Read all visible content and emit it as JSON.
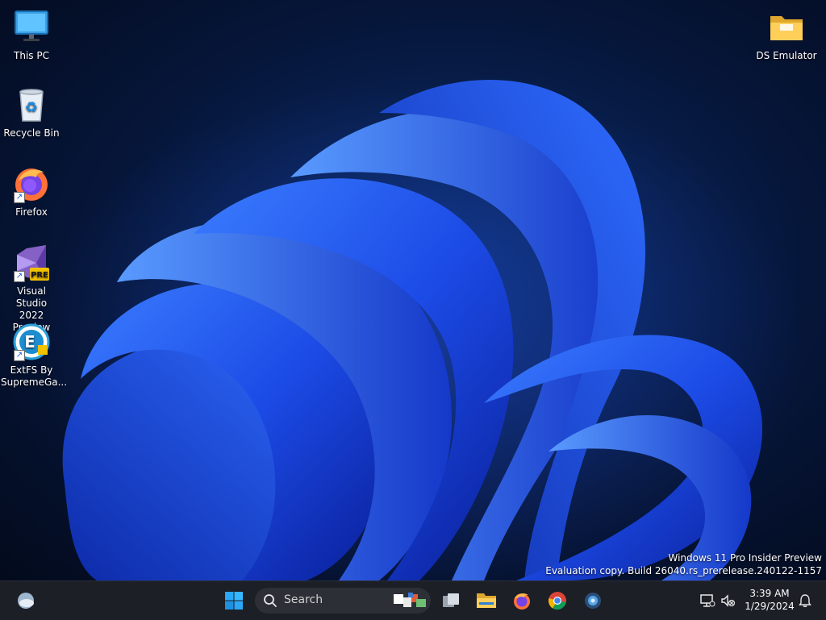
{
  "desktop_icons": [
    {
      "name": "This PC",
      "icon": "monitor-icon"
    },
    {
      "name": "Recycle Bin",
      "icon": "recycle-bin-icon"
    },
    {
      "name": "Firefox",
      "icon": "firefox-icon"
    },
    {
      "name": "Visual Studio 2022 Preview",
      "line1": "Visual Studio",
      "line2": "2022 Preview",
      "badge": "PRE",
      "icon": "visual-studio-icon"
    },
    {
      "name": "ExtFS By SupremeGa...",
      "line1": "ExtFS By",
      "line2": "SupremeGa...",
      "badge": "E",
      "icon": "extfs-icon"
    },
    {
      "name": "DS Emulator",
      "icon": "folder-icon"
    }
  ],
  "watermark": {
    "line1": "Windows 11 Pro Insider Preview",
    "line2": "Evaluation copy. Build 26040.rs_prerelease.240122-1157"
  },
  "taskbar": {
    "search_label": "Search",
    "apps": [
      {
        "name": "Start",
        "icon": "windows-start-icon"
      },
      {
        "name": "Task View",
        "icon": "task-view-icon"
      },
      {
        "name": "File Explorer",
        "icon": "file-explorer-icon"
      },
      {
        "name": "Firefox",
        "icon": "firefox-icon"
      },
      {
        "name": "Google Chrome",
        "icon": "chrome-icon"
      },
      {
        "name": "App",
        "icon": "app-icon"
      }
    ],
    "clock": {
      "time": "3:39 AM",
      "date": "1/29/2024"
    }
  },
  "colors": {
    "taskbar_bg": "#1c1f26",
    "accent_blue": "#1a5fd6",
    "desktop_bg": "#06163a"
  }
}
